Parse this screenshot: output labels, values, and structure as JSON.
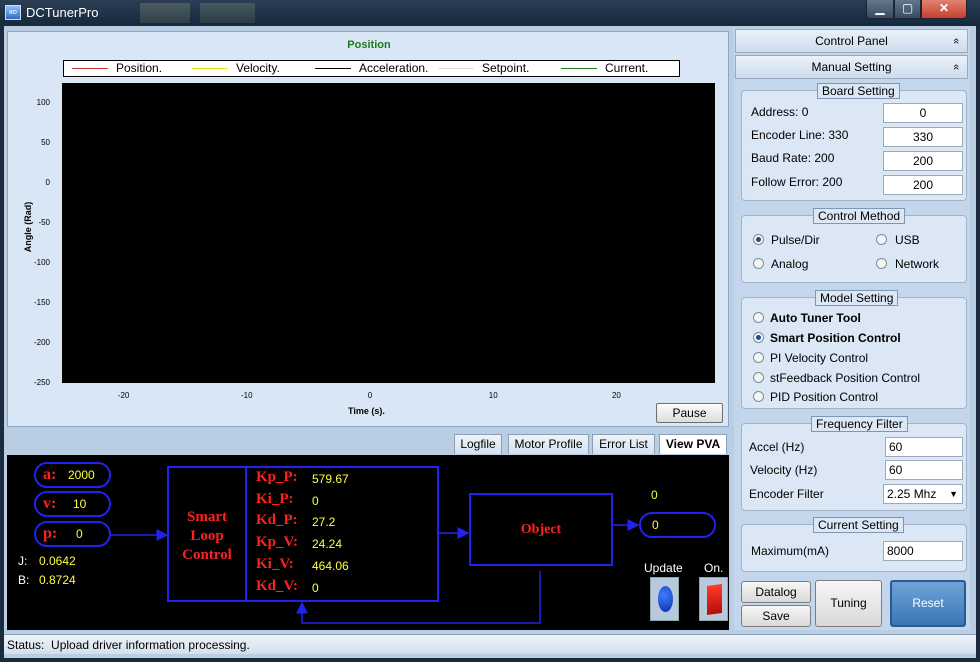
{
  "window": {
    "title": "DCTunerPro",
    "min_glyph": "▁",
    "max_glyph": "▢",
    "close_glyph": "✕"
  },
  "chart": {
    "title": "Position",
    "legend": [
      {
        "name": "Position.",
        "color": "#d23030"
      },
      {
        "name": "Velocity.",
        "color": "#e6e600"
      },
      {
        "name": "Acceleration.",
        "color": "#000000"
      },
      {
        "name": "Setpoint.",
        "color": "#dddddd"
      },
      {
        "name": "Current.",
        "color": "#1a7a1a"
      }
    ],
    "ylabel": "Angle (Rad)",
    "xlabel": "Time (s).",
    "yticks": [
      "100",
      "50",
      "0",
      "-50",
      "-100",
      "-150",
      "-200",
      "-250"
    ],
    "xticks": [
      "-20",
      "-10",
      "0",
      "10",
      "20"
    ],
    "pause_label": "Pause"
  },
  "chart_data": {
    "type": "line",
    "title": "Position",
    "xlabel": "Time (s).",
    "ylabel": "Angle (Rad)",
    "xlim": [
      -25,
      28
    ],
    "ylim": [
      -250,
      125
    ],
    "series": [
      {
        "name": "Position.",
        "values": []
      },
      {
        "name": "Velocity.",
        "values": []
      },
      {
        "name": "Acceleration.",
        "values": []
      },
      {
        "name": "Setpoint.",
        "values": []
      },
      {
        "name": "Current.",
        "values": []
      }
    ]
  },
  "tabs": [
    "Logfile",
    "Motor Profile",
    "Error List",
    "View PVA"
  ],
  "diagram": {
    "a_label": "a:",
    "a_value": "2000",
    "v_label": "v:",
    "v_value": "10",
    "p_label": "p:",
    "p_value": "0",
    "j_label": "J:",
    "j_value": "0.0642",
    "b_label": "B:",
    "b_value": "0.8724",
    "controller_line1": "Smart",
    "controller_line2": "Loop",
    "controller_line3": "Control",
    "gains": [
      {
        "name": "Kp_P:",
        "value": "579.67"
      },
      {
        "name": "Ki_P:",
        "value": "0"
      },
      {
        "name": "Kd_P:",
        "value": "27.2"
      },
      {
        "name": "Kp_V:",
        "value": "24.24"
      },
      {
        "name": "Ki_V:",
        "value": "464.06"
      },
      {
        "name": "Kd_V:",
        "value": "0"
      }
    ],
    "object_label": "Object",
    "output_top": "0",
    "output_value": "0",
    "update_label": "Update",
    "on_label": "On."
  },
  "status": {
    "label": "Status:",
    "text": "Upload driver information processing."
  },
  "right_panel": {
    "control_panel": "Control Panel",
    "manual_setting": "Manual Setting",
    "chevron": "«",
    "board_setting": {
      "title": "Board Setting",
      "rows": [
        {
          "label": "Address: 0",
          "value": "0"
        },
        {
          "label": "Encoder Line: 330",
          "value": "330"
        },
        {
          "label": "Baud Rate: 200",
          "value": "200"
        },
        {
          "label": "Follow Error: 200",
          "value": "200"
        }
      ]
    },
    "control_method": {
      "title": "Control Method",
      "options": [
        {
          "label": "Pulse/Dir",
          "selected": true
        },
        {
          "label": "USB",
          "selected": false
        },
        {
          "label": "Analog",
          "selected": false
        },
        {
          "label": "Network",
          "selected": false
        }
      ]
    },
    "model_setting": {
      "title": "Model Setting",
      "options": [
        {
          "label": "Auto Tuner Tool",
          "selected": false
        },
        {
          "label": "Smart Position Control",
          "selected": true
        },
        {
          "label": "PI Velocity Control",
          "selected": false
        },
        {
          "label": "stFeedback Position Control",
          "selected": false
        },
        {
          "label": "PID Position Control",
          "selected": false
        }
      ]
    },
    "frequency_filter": {
      "title": "Frequency Filter",
      "accel_label": "Accel (Hz)",
      "accel_value": "60",
      "velocity_label": "Velocity (Hz)",
      "velocity_value": "60",
      "encoder_label": "Encoder Filter",
      "encoder_value": "2.25 Mhz"
    },
    "current_setting": {
      "title": "Current Setting",
      "max_label": "Maximum(mA)",
      "max_value": "8000"
    },
    "buttons": {
      "datalog": "Datalog",
      "save": "Save",
      "tuning": "Tuning",
      "reset": "Reset"
    }
  }
}
